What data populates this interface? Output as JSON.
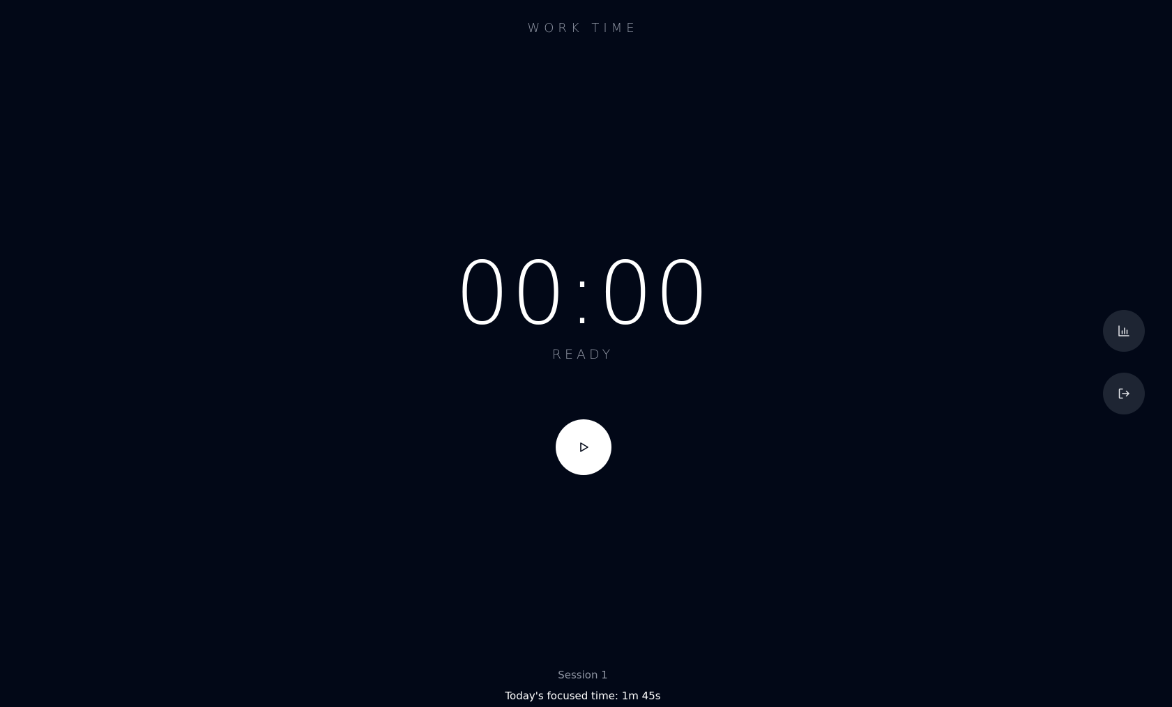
{
  "header": {
    "mode_label": "WORK TIME"
  },
  "timer": {
    "display": "00:00",
    "status": "READY"
  },
  "controls": {
    "play_icon": "play-icon"
  },
  "side_actions": {
    "stats_icon": "bar-chart-icon",
    "logout_icon": "logout-icon"
  },
  "footer": {
    "session": "Session 1",
    "focused_label": "Today's focused time: ",
    "focused_value": "1m 45s"
  },
  "colors": {
    "background": "#020817",
    "muted_text": "#8f95a3",
    "primary_text": "#ffffff",
    "side_button": "#1e2533"
  }
}
